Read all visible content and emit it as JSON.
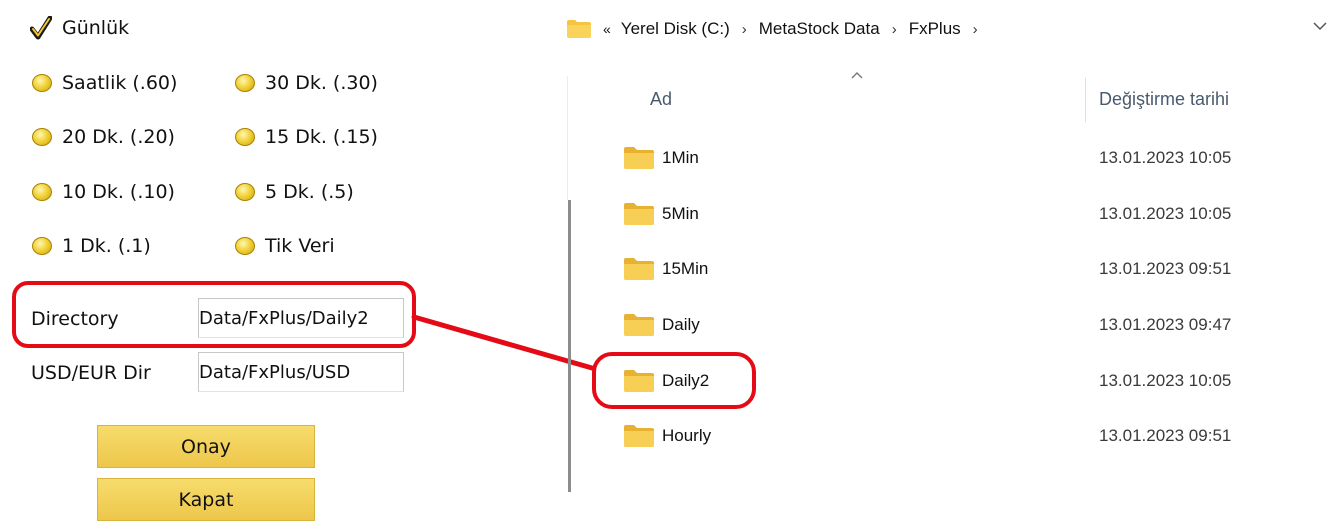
{
  "dialog": {
    "daily_checkbox": {
      "label": "Günlük",
      "checked": true
    },
    "radio_options": [
      {
        "label": "Saatlik (.60)"
      },
      {
        "label": "30 Dk. (.30)"
      },
      {
        "label": "20 Dk. (.20)"
      },
      {
        "label": "15 Dk. (.15)"
      },
      {
        "label": "10 Dk. (.10)"
      },
      {
        "label": "5 Dk. (.5)"
      },
      {
        "label": "1 Dk. (.1)"
      },
      {
        "label": "Tik Veri"
      }
    ],
    "directory_label": "Directory",
    "directory_value": "Data/FxPlus/Daily2",
    "usdeur_label": "USD/EUR Dir",
    "usdeur_value": "Data/FxPlus/USD",
    "confirm_button": "Onay",
    "close_button": "Kapat"
  },
  "explorer": {
    "overflow_chevron": "«",
    "breadcrumb": [
      "Yerel Disk (C:)",
      "MetaStock Data",
      "FxPlus"
    ],
    "columns": {
      "name": "Ad",
      "modified": "Değiştirme tarihi"
    },
    "rows": [
      {
        "name": "1Min",
        "date": "13.01.2023 10:05"
      },
      {
        "name": "5Min",
        "date": "13.01.2023 10:05"
      },
      {
        "name": "15Min",
        "date": "13.01.2023 09:51"
      },
      {
        "name": "Daily",
        "date": "13.01.2023 09:47"
      },
      {
        "name": "Daily2",
        "date": "13.01.2023 10:05"
      },
      {
        "name": "Hourly",
        "date": "13.01.2023 09:51"
      }
    ]
  },
  "icons": {
    "check": "check-icon",
    "folder": "folder-icon",
    "sort": "sort-up-icon",
    "dropdown": "chevron-down-icon"
  },
  "colors": {
    "highlight": "#e40b16",
    "button_fill": "#f0cd55",
    "radio_fill": "#f2d33c",
    "folder": "#f5c542"
  }
}
